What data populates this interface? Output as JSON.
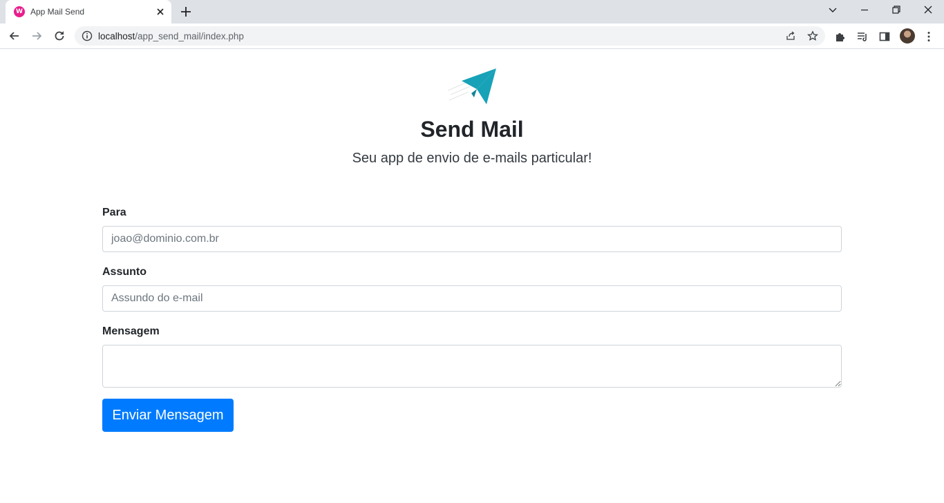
{
  "browser": {
    "tab": {
      "title": "App Mail Send",
      "favicon_letter": "W"
    },
    "url": {
      "host": "localhost",
      "path": "/app_send_mail/index.php"
    },
    "icons": [
      "back-icon",
      "forward-icon",
      "reload-icon",
      "info-icon",
      "share-icon",
      "star-icon",
      "extensions-icon",
      "reading-list-icon",
      "side-panel-icon",
      "menu-icon"
    ]
  },
  "page": {
    "logo_icon": "paper-plane-icon",
    "title": "Send Mail",
    "subtitle": "Seu app de envio de e-mails particular!"
  },
  "form": {
    "to": {
      "label": "Para",
      "placeholder": "joao@dominio.com.br",
      "value": ""
    },
    "subject": {
      "label": "Assunto",
      "placeholder": "Assundo do e-mail",
      "value": ""
    },
    "message": {
      "label": "Mensagem",
      "value": ""
    },
    "submit_label": "Enviar Mensagem"
  },
  "colors": {
    "primary": "#007bff",
    "logo": "#17a2b8",
    "text": "#212529"
  }
}
